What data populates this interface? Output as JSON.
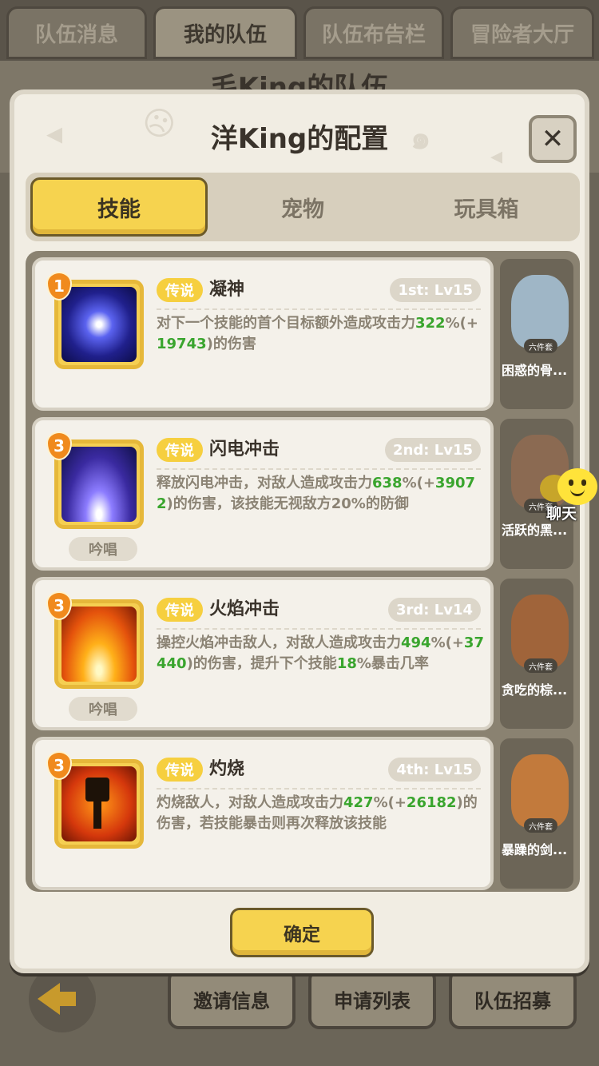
{
  "top_tabs": [
    {
      "label": "队伍消息",
      "active": false
    },
    {
      "label": "我的队伍",
      "active": true
    },
    {
      "label": "队伍布告栏",
      "active": false
    },
    {
      "label": "冒险者大厅",
      "active": false
    }
  ],
  "background_title": "毛King的队伍",
  "modal": {
    "title": "洋King的配置",
    "tabs": [
      {
        "label": "技能",
        "active": true
      },
      {
        "label": "宠物",
        "active": false
      },
      {
        "label": "玩具箱",
        "active": false
      }
    ],
    "skills": [
      {
        "level_badge": "1",
        "rarity": "传说",
        "name": "凝神",
        "slot": "1st: Lv15",
        "chant": "",
        "desc_parts": [
          {
            "text": "对下一个技能的首个目标额外造成攻击力",
            "hl": false
          },
          {
            "text": "322",
            "hl": true
          },
          {
            "text": "%(+",
            "hl": false
          },
          {
            "text": "19743",
            "hl": true
          },
          {
            "text": ")的伤害",
            "hl": false
          }
        ],
        "icon": "focus-eye-icon"
      },
      {
        "level_badge": "3",
        "rarity": "传说",
        "name": "闪电冲击",
        "slot": "2nd: Lv15",
        "chant": "吟唱",
        "desc_parts": [
          {
            "text": "释放闪电冲击，对敌人造成攻击力",
            "hl": false
          },
          {
            "text": "638",
            "hl": true
          },
          {
            "text": "%(+",
            "hl": false
          },
          {
            "text": "39072",
            "hl": true
          },
          {
            "text": ")的伤害，该技能无视敌方20%的防御",
            "hl": false
          }
        ],
        "icon": "lightning-strike-icon"
      },
      {
        "level_badge": "3",
        "rarity": "传说",
        "name": "火焰冲击",
        "slot": "3rd: Lv14",
        "chant": "吟唱",
        "desc_parts": [
          {
            "text": "操控火焰冲击敌人，对敌人造成攻击力",
            "hl": false
          },
          {
            "text": "494",
            "hl": true
          },
          {
            "text": "%(+",
            "hl": false
          },
          {
            "text": "37440",
            "hl": true
          },
          {
            "text": ")的伤害，提升下个技能",
            "hl": false
          },
          {
            "text": "18",
            "hl": true
          },
          {
            "text": "%暴击几率",
            "hl": false
          }
        ],
        "icon": "fire-blast-icon"
      },
      {
        "level_badge": "3",
        "rarity": "传说",
        "name": "灼烧",
        "slot": "4th: Lv15",
        "chant": "",
        "desc_parts": [
          {
            "text": "灼烧敌人，对敌人造成攻击力",
            "hl": false
          },
          {
            "text": "427",
            "hl": true
          },
          {
            "text": "%(+",
            "hl": false
          },
          {
            "text": "26182",
            "hl": true
          },
          {
            "text": ")的伤害，若技能暴击则再次释放该技能",
            "hl": false
          }
        ],
        "icon": "burning-figure-icon"
      }
    ],
    "pets": [
      {
        "name": "困惑的骨...",
        "set_label": "六件套",
        "color": "#9fb6c6"
      },
      {
        "name": "活跃的黑...",
        "set_label": "六件套",
        "color": "#8b6a52"
      },
      {
        "name": "贪吃的棕...",
        "set_label": "六件套",
        "color": "#a0643a"
      },
      {
        "name": "暴躁的剑...",
        "set_label": "六件套",
        "color": "#c27a3c"
      }
    ],
    "confirm_label": "确定"
  },
  "chat": {
    "label": "聊天"
  },
  "bottom_buttons": [
    "邀请信息",
    "申请列表",
    "队伍招募"
  ]
}
